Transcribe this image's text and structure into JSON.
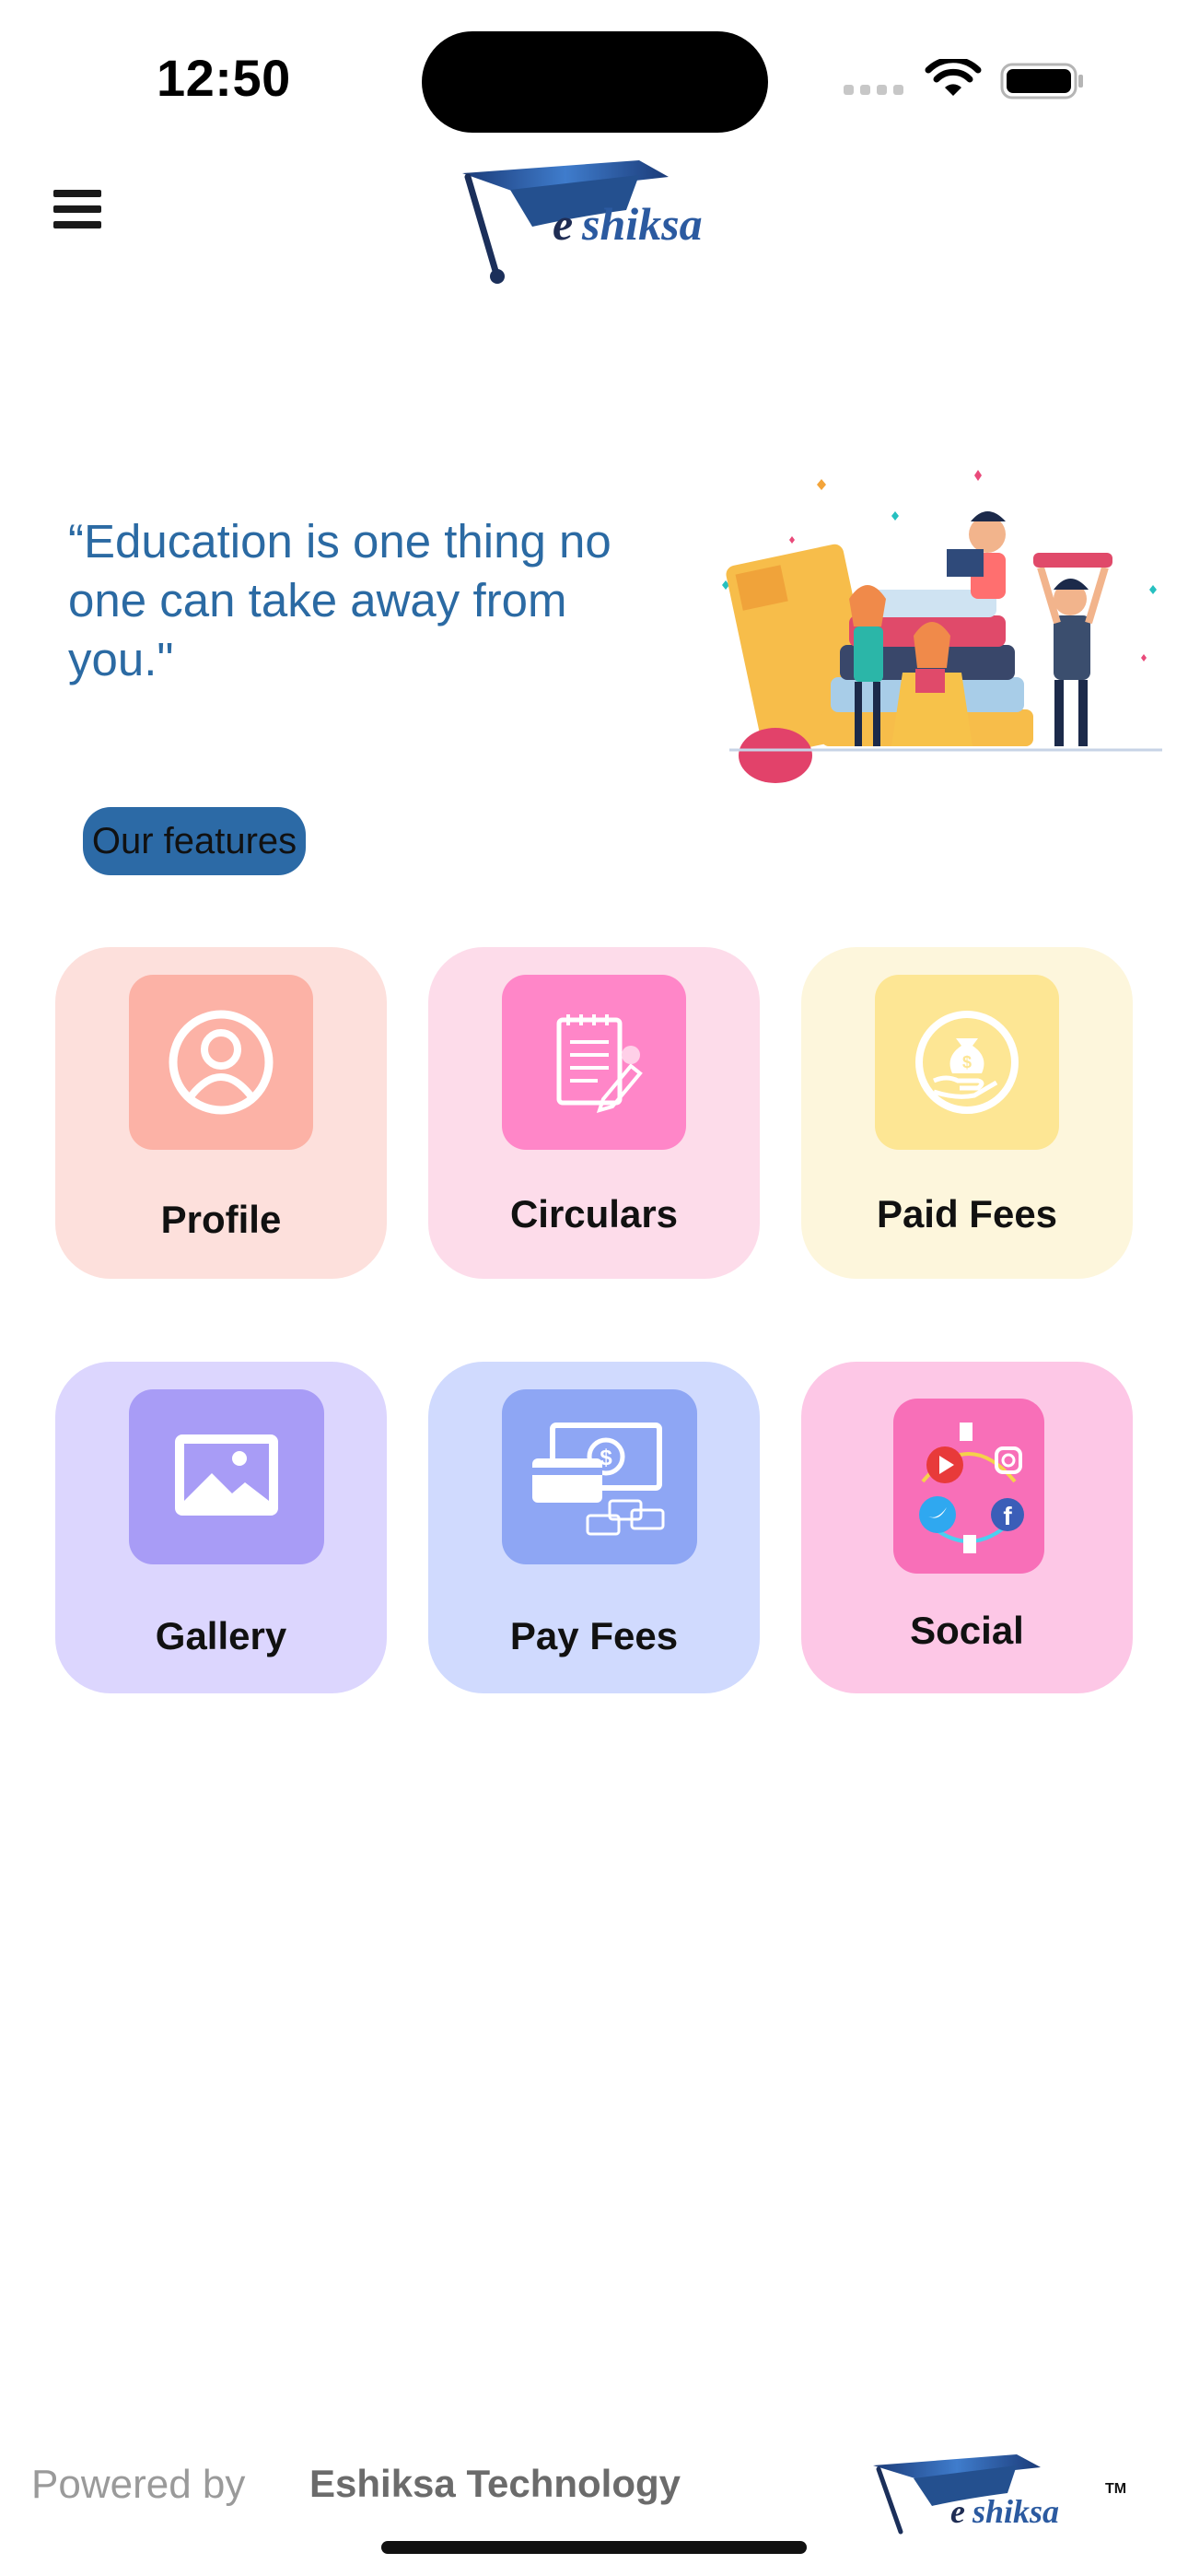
{
  "status_bar": {
    "time": "12:50"
  },
  "header": {
    "menu_icon": "hamburger-menu-icon",
    "logo_text": "eshiksa"
  },
  "hero": {
    "quote": "“Education is one thing no one can take away from you.\""
  },
  "features_label": "Our features",
  "features": [
    {
      "label": "Profile",
      "icon": "user-circle-icon"
    },
    {
      "label": "Circulars",
      "icon": "notepad-icon"
    },
    {
      "label": "Paid Fees",
      "icon": "money-bag-hand-icon"
    },
    {
      "label": "Gallery",
      "icon": "image-icon"
    },
    {
      "label": "Pay Fees",
      "icon": "cash-card-icon"
    },
    {
      "label": "Social",
      "icon": "social-media-icon"
    }
  ],
  "footer": {
    "powered_by": "Powered by",
    "company": "Eshiksa Technology",
    "logo_text": "eshiksa",
    "trademark": "TM"
  },
  "colors": {
    "brand_blue": "#2b6aa3",
    "logo_navy": "#1f3f7a"
  }
}
